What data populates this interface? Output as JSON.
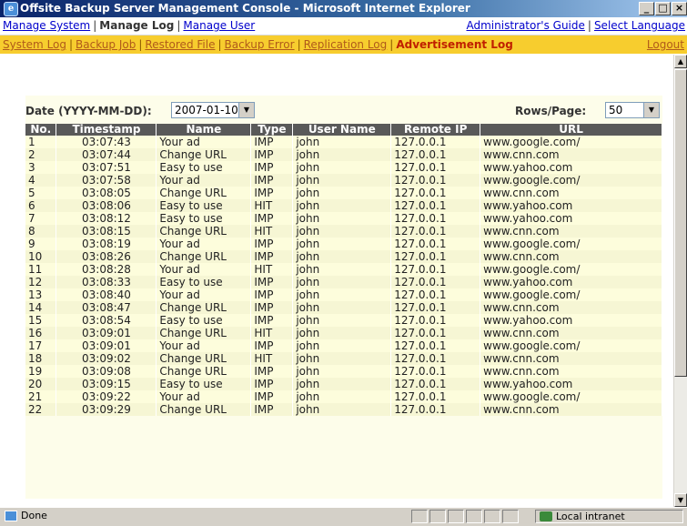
{
  "window": {
    "title": "Offsite Backup Server Management Console - Microsoft Internet Explorer",
    "minimize": "_",
    "maximize": "□",
    "close": "×"
  },
  "top_menu": {
    "left": [
      {
        "label": "Manage System",
        "active": false
      },
      {
        "label": "Manage Log",
        "active": true
      },
      {
        "label": "Manage User",
        "active": false
      }
    ],
    "right": [
      {
        "label": "Administrator's Guide"
      },
      {
        "label": "Select Language"
      }
    ]
  },
  "sub_menu": {
    "items": [
      {
        "label": "System Log",
        "active": false
      },
      {
        "label": "Backup Job",
        "active": false
      },
      {
        "label": "Restored File",
        "active": false
      },
      {
        "label": "Backup Error",
        "active": false
      },
      {
        "label": "Replication Log",
        "active": false
      },
      {
        "label": "Advertisement Log",
        "active": true
      }
    ],
    "logout": "Logout"
  },
  "controls": {
    "date_label": "Date (YYYY-MM-DD):",
    "date_value": "2007-01-10",
    "rows_label": "Rows/Page:",
    "rows_value": "50"
  },
  "table": {
    "columns": [
      "No.",
      "Timestamp",
      "Name",
      "Type",
      "User Name",
      "Remote IP",
      "URL"
    ],
    "rows": [
      [
        "1",
        "03:07:43",
        "Your ad",
        "IMP",
        "john",
        "127.0.0.1",
        "www.google.com/"
      ],
      [
        "2",
        "03:07:44",
        "Change URL",
        "IMP",
        "john",
        "127.0.0.1",
        "www.cnn.com"
      ],
      [
        "3",
        "03:07:51",
        "Easy to use",
        "IMP",
        "john",
        "127.0.0.1",
        "www.yahoo.com"
      ],
      [
        "4",
        "03:07:58",
        "Your ad",
        "IMP",
        "john",
        "127.0.0.1",
        "www.google.com/"
      ],
      [
        "5",
        "03:08:05",
        "Change URL",
        "IMP",
        "john",
        "127.0.0.1",
        "www.cnn.com"
      ],
      [
        "6",
        "03:08:06",
        "Easy to use",
        "HIT",
        "john",
        "127.0.0.1",
        "www.yahoo.com"
      ],
      [
        "7",
        "03:08:12",
        "Easy to use",
        "IMP",
        "john",
        "127.0.0.1",
        "www.yahoo.com"
      ],
      [
        "8",
        "03:08:15",
        "Change URL",
        "HIT",
        "john",
        "127.0.0.1",
        "www.cnn.com"
      ],
      [
        "9",
        "03:08:19",
        "Your ad",
        "IMP",
        "john",
        "127.0.0.1",
        "www.google.com/"
      ],
      [
        "10",
        "03:08:26",
        "Change URL",
        "IMP",
        "john",
        "127.0.0.1",
        "www.cnn.com"
      ],
      [
        "11",
        "03:08:28",
        "Your ad",
        "HIT",
        "john",
        "127.0.0.1",
        "www.google.com/"
      ],
      [
        "12",
        "03:08:33",
        "Easy to use",
        "IMP",
        "john",
        "127.0.0.1",
        "www.yahoo.com"
      ],
      [
        "13",
        "03:08:40",
        "Your ad",
        "IMP",
        "john",
        "127.0.0.1",
        "www.google.com/"
      ],
      [
        "14",
        "03:08:47",
        "Change URL",
        "IMP",
        "john",
        "127.0.0.1",
        "www.cnn.com"
      ],
      [
        "15",
        "03:08:54",
        "Easy to use",
        "IMP",
        "john",
        "127.0.0.1",
        "www.yahoo.com"
      ],
      [
        "16",
        "03:09:01",
        "Change URL",
        "HIT",
        "john",
        "127.0.0.1",
        "www.cnn.com"
      ],
      [
        "17",
        "03:09:01",
        "Your ad",
        "IMP",
        "john",
        "127.0.0.1",
        "www.google.com/"
      ],
      [
        "18",
        "03:09:02",
        "Change URL",
        "HIT",
        "john",
        "127.0.0.1",
        "www.cnn.com"
      ],
      [
        "19",
        "03:09:08",
        "Change URL",
        "IMP",
        "john",
        "127.0.0.1",
        "www.cnn.com"
      ],
      [
        "20",
        "03:09:15",
        "Easy to use",
        "IMP",
        "john",
        "127.0.0.1",
        "www.yahoo.com"
      ],
      [
        "21",
        "03:09:22",
        "Your ad",
        "IMP",
        "john",
        "127.0.0.1",
        "www.google.com/"
      ],
      [
        "22",
        "03:09:29",
        "Change URL",
        "IMP",
        "john",
        "127.0.0.1",
        "www.cnn.com"
      ]
    ]
  },
  "status": {
    "text": "Done",
    "zone": "Local intranet"
  },
  "colors": {
    "title_bar": "#0a246a",
    "sub_menu_bg": "#f7cd2e",
    "active_sub": "#c02000",
    "header_bg": "#595959",
    "row_bg": "#fdfddc"
  }
}
